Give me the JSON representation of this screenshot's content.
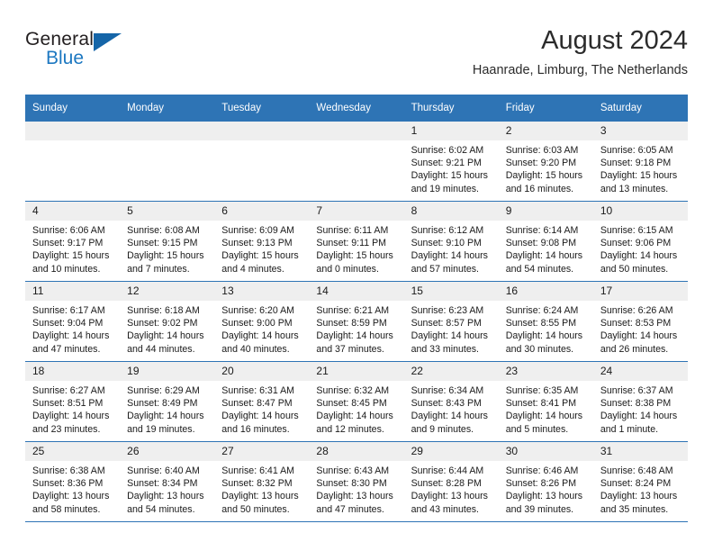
{
  "brand": {
    "name_part1": "General",
    "name_part2": "Blue",
    "triangle_color": "#1565a8",
    "blue_text_color": "#1d78c1"
  },
  "header": {
    "title": "August 2024",
    "location": "Haanrade, Limburg, The Netherlands"
  },
  "theme": {
    "header_blue": "#2e74b5",
    "day_band_gray": "#efefef"
  },
  "weekdays": [
    "Sunday",
    "Monday",
    "Tuesday",
    "Wednesday",
    "Thursday",
    "Friday",
    "Saturday"
  ],
  "weeks": [
    [
      {
        "day": "",
        "sunrise": "",
        "sunset": "",
        "daylight1": "",
        "daylight2": ""
      },
      {
        "day": "",
        "sunrise": "",
        "sunset": "",
        "daylight1": "",
        "daylight2": ""
      },
      {
        "day": "",
        "sunrise": "",
        "sunset": "",
        "daylight1": "",
        "daylight2": ""
      },
      {
        "day": "",
        "sunrise": "",
        "sunset": "",
        "daylight1": "",
        "daylight2": ""
      },
      {
        "day": "1",
        "sunrise": "Sunrise: 6:02 AM",
        "sunset": "Sunset: 9:21 PM",
        "daylight1": "Daylight: 15 hours",
        "daylight2": "and 19 minutes."
      },
      {
        "day": "2",
        "sunrise": "Sunrise: 6:03 AM",
        "sunset": "Sunset: 9:20 PM",
        "daylight1": "Daylight: 15 hours",
        "daylight2": "and 16 minutes."
      },
      {
        "day": "3",
        "sunrise": "Sunrise: 6:05 AM",
        "sunset": "Sunset: 9:18 PM",
        "daylight1": "Daylight: 15 hours",
        "daylight2": "and 13 minutes."
      }
    ],
    [
      {
        "day": "4",
        "sunrise": "Sunrise: 6:06 AM",
        "sunset": "Sunset: 9:17 PM",
        "daylight1": "Daylight: 15 hours",
        "daylight2": "and 10 minutes."
      },
      {
        "day": "5",
        "sunrise": "Sunrise: 6:08 AM",
        "sunset": "Sunset: 9:15 PM",
        "daylight1": "Daylight: 15 hours",
        "daylight2": "and 7 minutes."
      },
      {
        "day": "6",
        "sunrise": "Sunrise: 6:09 AM",
        "sunset": "Sunset: 9:13 PM",
        "daylight1": "Daylight: 15 hours",
        "daylight2": "and 4 minutes."
      },
      {
        "day": "7",
        "sunrise": "Sunrise: 6:11 AM",
        "sunset": "Sunset: 9:11 PM",
        "daylight1": "Daylight: 15 hours",
        "daylight2": "and 0 minutes."
      },
      {
        "day": "8",
        "sunrise": "Sunrise: 6:12 AM",
        "sunset": "Sunset: 9:10 PM",
        "daylight1": "Daylight: 14 hours",
        "daylight2": "and 57 minutes."
      },
      {
        "day": "9",
        "sunrise": "Sunrise: 6:14 AM",
        "sunset": "Sunset: 9:08 PM",
        "daylight1": "Daylight: 14 hours",
        "daylight2": "and 54 minutes."
      },
      {
        "day": "10",
        "sunrise": "Sunrise: 6:15 AM",
        "sunset": "Sunset: 9:06 PM",
        "daylight1": "Daylight: 14 hours",
        "daylight2": "and 50 minutes."
      }
    ],
    [
      {
        "day": "11",
        "sunrise": "Sunrise: 6:17 AM",
        "sunset": "Sunset: 9:04 PM",
        "daylight1": "Daylight: 14 hours",
        "daylight2": "and 47 minutes."
      },
      {
        "day": "12",
        "sunrise": "Sunrise: 6:18 AM",
        "sunset": "Sunset: 9:02 PM",
        "daylight1": "Daylight: 14 hours",
        "daylight2": "and 44 minutes."
      },
      {
        "day": "13",
        "sunrise": "Sunrise: 6:20 AM",
        "sunset": "Sunset: 9:00 PM",
        "daylight1": "Daylight: 14 hours",
        "daylight2": "and 40 minutes."
      },
      {
        "day": "14",
        "sunrise": "Sunrise: 6:21 AM",
        "sunset": "Sunset: 8:59 PM",
        "daylight1": "Daylight: 14 hours",
        "daylight2": "and 37 minutes."
      },
      {
        "day": "15",
        "sunrise": "Sunrise: 6:23 AM",
        "sunset": "Sunset: 8:57 PM",
        "daylight1": "Daylight: 14 hours",
        "daylight2": "and 33 minutes."
      },
      {
        "day": "16",
        "sunrise": "Sunrise: 6:24 AM",
        "sunset": "Sunset: 8:55 PM",
        "daylight1": "Daylight: 14 hours",
        "daylight2": "and 30 minutes."
      },
      {
        "day": "17",
        "sunrise": "Sunrise: 6:26 AM",
        "sunset": "Sunset: 8:53 PM",
        "daylight1": "Daylight: 14 hours",
        "daylight2": "and 26 minutes."
      }
    ],
    [
      {
        "day": "18",
        "sunrise": "Sunrise: 6:27 AM",
        "sunset": "Sunset: 8:51 PM",
        "daylight1": "Daylight: 14 hours",
        "daylight2": "and 23 minutes."
      },
      {
        "day": "19",
        "sunrise": "Sunrise: 6:29 AM",
        "sunset": "Sunset: 8:49 PM",
        "daylight1": "Daylight: 14 hours",
        "daylight2": "and 19 minutes."
      },
      {
        "day": "20",
        "sunrise": "Sunrise: 6:31 AM",
        "sunset": "Sunset: 8:47 PM",
        "daylight1": "Daylight: 14 hours",
        "daylight2": "and 16 minutes."
      },
      {
        "day": "21",
        "sunrise": "Sunrise: 6:32 AM",
        "sunset": "Sunset: 8:45 PM",
        "daylight1": "Daylight: 14 hours",
        "daylight2": "and 12 minutes."
      },
      {
        "day": "22",
        "sunrise": "Sunrise: 6:34 AM",
        "sunset": "Sunset: 8:43 PM",
        "daylight1": "Daylight: 14 hours",
        "daylight2": "and 9 minutes."
      },
      {
        "day": "23",
        "sunrise": "Sunrise: 6:35 AM",
        "sunset": "Sunset: 8:41 PM",
        "daylight1": "Daylight: 14 hours",
        "daylight2": "and 5 minutes."
      },
      {
        "day": "24",
        "sunrise": "Sunrise: 6:37 AM",
        "sunset": "Sunset: 8:38 PM",
        "daylight1": "Daylight: 14 hours",
        "daylight2": "and 1 minute."
      }
    ],
    [
      {
        "day": "25",
        "sunrise": "Sunrise: 6:38 AM",
        "sunset": "Sunset: 8:36 PM",
        "daylight1": "Daylight: 13 hours",
        "daylight2": "and 58 minutes."
      },
      {
        "day": "26",
        "sunrise": "Sunrise: 6:40 AM",
        "sunset": "Sunset: 8:34 PM",
        "daylight1": "Daylight: 13 hours",
        "daylight2": "and 54 minutes."
      },
      {
        "day": "27",
        "sunrise": "Sunrise: 6:41 AM",
        "sunset": "Sunset: 8:32 PM",
        "daylight1": "Daylight: 13 hours",
        "daylight2": "and 50 minutes."
      },
      {
        "day": "28",
        "sunrise": "Sunrise: 6:43 AM",
        "sunset": "Sunset: 8:30 PM",
        "daylight1": "Daylight: 13 hours",
        "daylight2": "and 47 minutes."
      },
      {
        "day": "29",
        "sunrise": "Sunrise: 6:44 AM",
        "sunset": "Sunset: 8:28 PM",
        "daylight1": "Daylight: 13 hours",
        "daylight2": "and 43 minutes."
      },
      {
        "day": "30",
        "sunrise": "Sunrise: 6:46 AM",
        "sunset": "Sunset: 8:26 PM",
        "daylight1": "Daylight: 13 hours",
        "daylight2": "and 39 minutes."
      },
      {
        "day": "31",
        "sunrise": "Sunrise: 6:48 AM",
        "sunset": "Sunset: 8:24 PM",
        "daylight1": "Daylight: 13 hours",
        "daylight2": "and 35 minutes."
      }
    ]
  ]
}
